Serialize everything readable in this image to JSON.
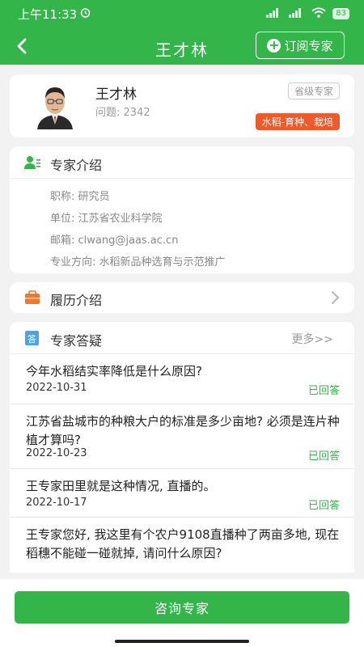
{
  "status": {
    "time": "上午11:33",
    "signal1": "5G",
    "signal2": "4G",
    "battery": "83"
  },
  "nav": {
    "title": "王才林",
    "subscribe_label": "订阅专家"
  },
  "profile": {
    "name": "王才林",
    "questions": "问题: 2342",
    "level": "省级专家",
    "field": "水稻-育种、栽培"
  },
  "intro": {
    "title": "专家介绍",
    "lines": [
      "职称: 研究员",
      "单位: 江苏省农业科学院",
      "邮箱: clwang@jaas.ac.cn",
      "专业方向: 水稻新品种选育与示范推广"
    ]
  },
  "resume": {
    "title": "履历介绍"
  },
  "qa": {
    "title": "专家答疑",
    "more": "更多>>",
    "items": [
      {
        "question": "今年水稻结实率降低是什么原因?",
        "date": "2022-10-31",
        "status": "已回答"
      },
      {
        "question": "江苏省盐城市的种粮大户的标准是多少亩地? 必须是连片种植才算吗?",
        "date": "2022-10-23",
        "status": "已回答"
      },
      {
        "question": "王专家田里就是这种情况, 直播的。",
        "date": "2022-10-17",
        "status": "已回答"
      },
      {
        "question": "王专家您好, 我这里有个农户9108直播种了两亩多地, 现在稻穗不能碰一碰就掉, 请问什么原因?",
        "date": "",
        "status": ""
      }
    ]
  },
  "bottom": {
    "consult_label": "咨询专家"
  },
  "colors": {
    "brand": "#33b54a",
    "field_badge": "#f05a2a"
  },
  "icons": [
    "back-arrow-icon",
    "plus-circle-icon",
    "expert-intro-icon",
    "resume-briefcase-icon",
    "qa-icon",
    "chevron-right-icon"
  ]
}
